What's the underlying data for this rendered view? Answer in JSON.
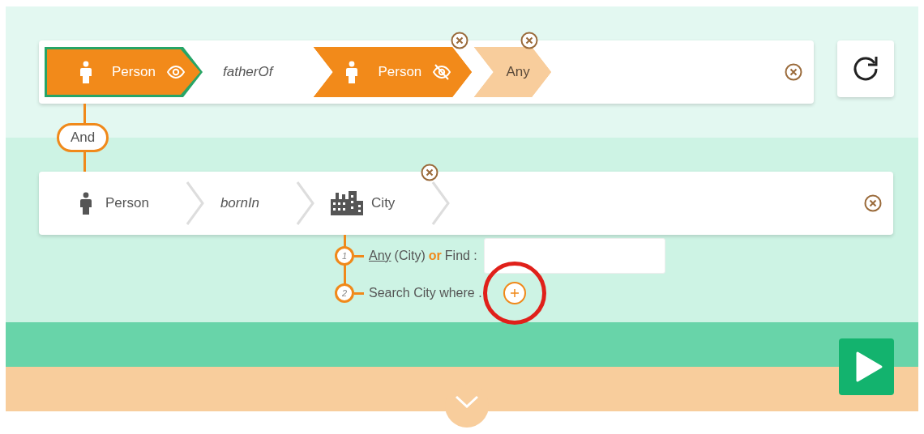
{
  "queries": [
    {
      "kind": "filled",
      "removable": true,
      "steps": [
        {
          "kind": "person",
          "label": "Person",
          "selected": true,
          "visible": true
        },
        {
          "kind": "relation",
          "label": "fatherOf"
        },
        {
          "kind": "person",
          "label": "Person",
          "selected": false,
          "visible": false,
          "removable": true
        },
        {
          "kind": "any",
          "label": "Any",
          "removable": true
        }
      ]
    },
    {
      "kind": "plain",
      "removable": true,
      "connector": "And",
      "steps": [
        {
          "kind": "person",
          "label": "Person"
        },
        {
          "kind": "relation",
          "label": "bornIn"
        },
        {
          "kind": "place",
          "label": "City",
          "removable": true
        }
      ],
      "options": [
        {
          "kind": "choice",
          "number": "1",
          "link": "Any",
          "text": "(City)",
          "conj": "or",
          "find": "Find :"
        },
        {
          "kind": "where",
          "number": "2",
          "text": "Search City where .",
          "highlighted": true
        }
      ]
    }
  ]
}
